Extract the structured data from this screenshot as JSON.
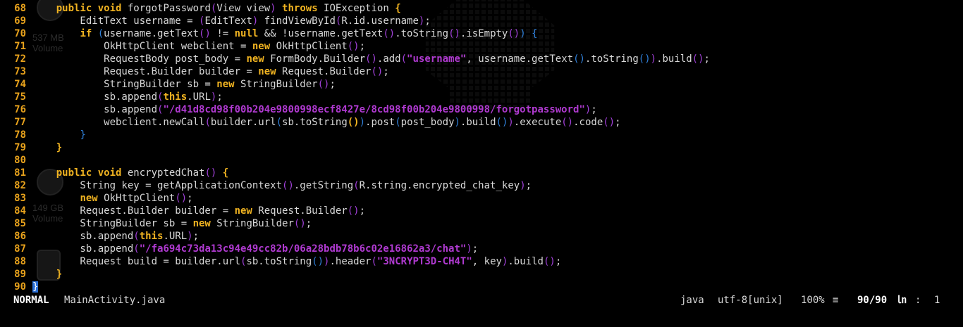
{
  "desktop": {
    "ghost1": "537 MB",
    "ghost1b": "Volume",
    "ghost2": "149 GB",
    "ghost2b": "Volume"
  },
  "code_lines": [
    {
      "n": "68",
      "tokens": [
        [
          "",
          "    "
        ],
        [
          "kw",
          "public void"
        ],
        [
          "code",
          " forgotPassword"
        ],
        [
          "pu",
          "("
        ],
        [
          "code",
          "View view"
        ],
        [
          "pu",
          ")"
        ],
        [
          "code",
          " "
        ],
        [
          "kw",
          "throws"
        ],
        [
          "code",
          " IOException "
        ],
        [
          "kw",
          "{"
        ]
      ]
    },
    {
      "n": "69",
      "tokens": [
        [
          "code",
          "        EditText username = "
        ],
        [
          "pu",
          "("
        ],
        [
          "code",
          "EditText"
        ],
        [
          "pu",
          ")"
        ],
        [
          "code",
          " findViewById"
        ],
        [
          "pu",
          "("
        ],
        [
          "code",
          "R.id.username"
        ],
        [
          "pu",
          ")"
        ],
        [
          "code",
          ";"
        ]
      ]
    },
    {
      "n": "70",
      "tokens": [
        [
          "code",
          "        "
        ],
        [
          "kw",
          "if"
        ],
        [
          "code",
          " "
        ],
        [
          "bl",
          "("
        ],
        [
          "code",
          "username.getText"
        ],
        [
          "pu",
          "()"
        ],
        [
          "code",
          " != "
        ],
        [
          "kw",
          "null"
        ],
        [
          "code",
          " && !username.getText"
        ],
        [
          "pu",
          "()"
        ],
        [
          "code",
          ".toString"
        ],
        [
          "pu",
          "()"
        ],
        [
          "code",
          ".isEmpty"
        ],
        [
          "pu",
          "()"
        ],
        [
          "bl",
          ")"
        ],
        [
          "code",
          " "
        ],
        [
          "bl",
          "{"
        ]
      ]
    },
    {
      "n": "71",
      "tokens": [
        [
          "code",
          "            OkHttpClient webclient = "
        ],
        [
          "kw",
          "new"
        ],
        [
          "code",
          " OkHttpClient"
        ],
        [
          "pu",
          "()"
        ],
        [
          "code",
          ";"
        ]
      ]
    },
    {
      "n": "72",
      "tokens": [
        [
          "code",
          "            RequestBody post_body = "
        ],
        [
          "kw",
          "new"
        ],
        [
          "code",
          " FormBody.Builder"
        ],
        [
          "pu",
          "()"
        ],
        [
          "code",
          ".add"
        ],
        [
          "pu",
          "("
        ],
        [
          "str",
          "\"username\""
        ],
        [
          "code",
          ", username.getText"
        ],
        [
          "bl",
          "()"
        ],
        [
          "code",
          ".toString"
        ],
        [
          "bl",
          "()"
        ],
        [
          "pu",
          ")"
        ],
        [
          "code",
          ".build"
        ],
        [
          "pu",
          "()"
        ],
        [
          "code",
          ";"
        ]
      ]
    },
    {
      "n": "73",
      "tokens": [
        [
          "code",
          "            Request.Builder builder = "
        ],
        [
          "kw",
          "new"
        ],
        [
          "code",
          " Request.Builder"
        ],
        [
          "pu",
          "()"
        ],
        [
          "code",
          ";"
        ]
      ]
    },
    {
      "n": "74",
      "tokens": [
        [
          "code",
          "            StringBuilder sb = "
        ],
        [
          "kw",
          "new"
        ],
        [
          "code",
          " StringBuilder"
        ],
        [
          "pu",
          "()"
        ],
        [
          "code",
          ";"
        ]
      ]
    },
    {
      "n": "75",
      "tokens": [
        [
          "code",
          "            sb.append"
        ],
        [
          "pu",
          "("
        ],
        [
          "kw",
          "this"
        ],
        [
          "code",
          ".URL"
        ],
        [
          "pu",
          ")"
        ],
        [
          "code",
          ";"
        ]
      ]
    },
    {
      "n": "76",
      "tokens": [
        [
          "code",
          "            sb.append"
        ],
        [
          "pu",
          "("
        ],
        [
          "str",
          "\"/d41d8cd98f00b204e9800998ecf8427e/8cd98f00b204e9800998/forgotpassword\""
        ],
        [
          "pu",
          ")"
        ],
        [
          "code",
          ";"
        ]
      ]
    },
    {
      "n": "77",
      "tokens": [
        [
          "code",
          "            webclient.newCall"
        ],
        [
          "pu",
          "("
        ],
        [
          "code",
          "builder.url"
        ],
        [
          "bl",
          "("
        ],
        [
          "code",
          "sb.toString"
        ],
        [
          "kw",
          "()"
        ],
        [
          "bl",
          ")"
        ],
        [
          "code",
          ".post"
        ],
        [
          "bl",
          "("
        ],
        [
          "code",
          "post_body"
        ],
        [
          "bl",
          ")"
        ],
        [
          "code",
          ".build"
        ],
        [
          "bl",
          "()"
        ],
        [
          "pu",
          ")"
        ],
        [
          "code",
          ".execute"
        ],
        [
          "pu",
          "()"
        ],
        [
          "code",
          ".code"
        ],
        [
          "pu",
          "()"
        ],
        [
          "code",
          ";"
        ]
      ]
    },
    {
      "n": "78",
      "tokens": [
        [
          "code",
          "        "
        ],
        [
          "bl",
          "}"
        ]
      ]
    },
    {
      "n": "79",
      "tokens": [
        [
          "code",
          "    "
        ],
        [
          "kw",
          "}"
        ]
      ]
    },
    {
      "n": "80",
      "tokens": [
        [
          "code",
          ""
        ]
      ]
    },
    {
      "n": "81",
      "tokens": [
        [
          "code",
          "    "
        ],
        [
          "kw",
          "public void"
        ],
        [
          "code",
          " encryptedChat"
        ],
        [
          "pu",
          "()"
        ],
        [
          "code",
          " "
        ],
        [
          "kw",
          "{"
        ]
      ]
    },
    {
      "n": "82",
      "tokens": [
        [
          "code",
          "        String key = getApplicationContext"
        ],
        [
          "pu",
          "()"
        ],
        [
          "code",
          ".getString"
        ],
        [
          "pu",
          "("
        ],
        [
          "code",
          "R.string.encrypted_chat_key"
        ],
        [
          "pu",
          ")"
        ],
        [
          "code",
          ";"
        ]
      ]
    },
    {
      "n": "83",
      "tokens": [
        [
          "code",
          "        "
        ],
        [
          "kw",
          "new"
        ],
        [
          "code",
          " OkHttpClient"
        ],
        [
          "pu",
          "()"
        ],
        [
          "code",
          ";"
        ]
      ]
    },
    {
      "n": "84",
      "tokens": [
        [
          "code",
          "        Request.Builder builder = "
        ],
        [
          "kw",
          "new"
        ],
        [
          "code",
          " Request.Builder"
        ],
        [
          "pu",
          "()"
        ],
        [
          "code",
          ";"
        ]
      ]
    },
    {
      "n": "85",
      "tokens": [
        [
          "code",
          "        StringBuilder sb = "
        ],
        [
          "kw",
          "new"
        ],
        [
          "code",
          " StringBuilder"
        ],
        [
          "pu",
          "()"
        ],
        [
          "code",
          ";"
        ]
      ]
    },
    {
      "n": "86",
      "tokens": [
        [
          "code",
          "        sb.append"
        ],
        [
          "pu",
          "("
        ],
        [
          "kw",
          "this"
        ],
        [
          "code",
          ".URL"
        ],
        [
          "pu",
          ")"
        ],
        [
          "code",
          ";"
        ]
      ]
    },
    {
      "n": "87",
      "tokens": [
        [
          "code",
          "        sb.append"
        ],
        [
          "pu",
          "("
        ],
        [
          "str",
          "\"/fa694c73da13c94e49cc82b/06a28bdb78b6c02e16862a3/chat\""
        ],
        [
          "pu",
          ")"
        ],
        [
          "code",
          ";"
        ]
      ]
    },
    {
      "n": "88",
      "tokens": [
        [
          "code",
          "        Request build = builder.url"
        ],
        [
          "pu",
          "("
        ],
        [
          "code",
          "sb.toString"
        ],
        [
          "bl",
          "()"
        ],
        [
          "pu",
          ")"
        ],
        [
          "code",
          ".header"
        ],
        [
          "pu",
          "("
        ],
        [
          "str",
          "\"3NCRYPT3D-CH4T\""
        ],
        [
          "code",
          ", key"
        ],
        [
          "pu",
          ")"
        ],
        [
          "code",
          ".build"
        ],
        [
          "pu",
          "()"
        ],
        [
          "code",
          ";"
        ]
      ]
    },
    {
      "n": "89",
      "tokens": [
        [
          "code",
          "    "
        ],
        [
          "kw",
          "}"
        ]
      ]
    },
    {
      "n": "90",
      "tokens": [
        [
          "cursor",
          "}"
        ]
      ]
    }
  ],
  "status": {
    "mode": "NORMAL",
    "filename": "MainActivity.java",
    "filetype": "java",
    "encoding": "utf-8[unix]",
    "percent": "100%",
    "percent_icon": "≡",
    "position": "90/90",
    "ln_icon": "㏑",
    "col_sep": ":",
    "column": "1"
  }
}
